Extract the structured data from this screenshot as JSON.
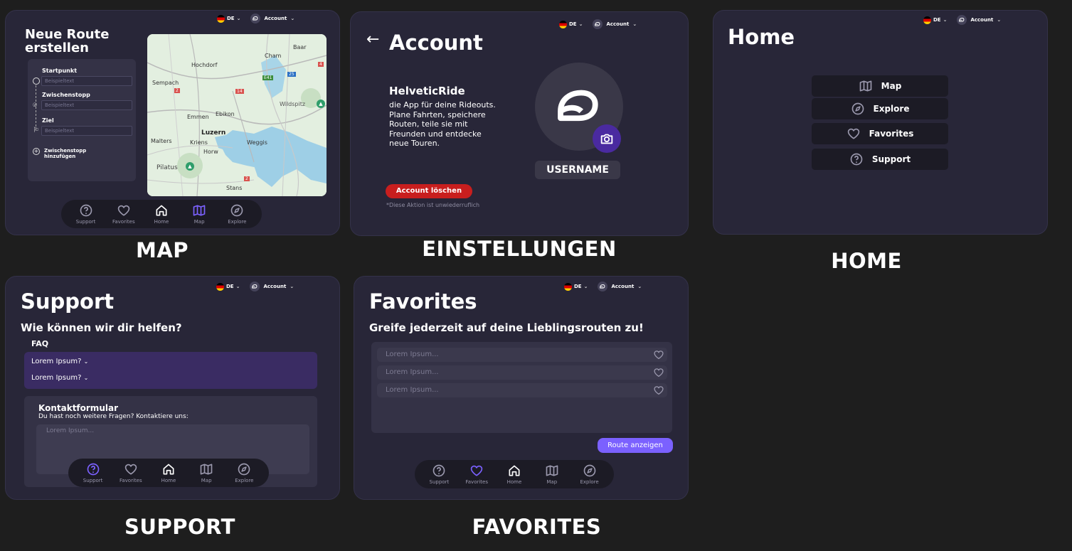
{
  "common": {
    "lang": "DE",
    "account": "Account",
    "nav": {
      "support": "Support",
      "favorites": "Favorites",
      "home": "Home",
      "map": "Map",
      "explore": "Explore"
    }
  },
  "captions": {
    "map": "MAP",
    "settings": "EINSTELLUNGEN",
    "home": "HOME",
    "support": "SUPPORT",
    "favorites": "FAVORITES"
  },
  "map_screen": {
    "title_line1": "Neue Route",
    "title_line2": "erstellen",
    "start_label": "Startpunkt",
    "via_label": "Zwischenstopp",
    "dest_label": "Ziel",
    "placeholder": "Beispieltext",
    "add_stop_line1": "Zwischenstopp",
    "add_stop_line2": "hinzufügen",
    "map_labels": {
      "baar": "Baar",
      "cham": "Cham",
      "hochdorf": "Hochdorf",
      "sempach": "Sempach",
      "emmen": "Emmen",
      "ebikon": "Ebikon",
      "wildspitz": "Wildspitz",
      "luzern": "Luzern",
      "malters": "Malters",
      "kriens": "Kriens",
      "horw": "Horw",
      "weggis": "Weggis",
      "pilatus": "Pilatus",
      "stans": "Stans",
      "r2a": "2",
      "r2b": "2",
      "r14": "14",
      "r25": "25",
      "e41": "E41",
      "r4": "4"
    }
  },
  "account_screen": {
    "title": "Account",
    "app_name": "HelveticRide",
    "description": "die App für deine Rideouts. Plane Fahrten, speichere Routen, teile sie mit Freunden und entdecke neue Touren.",
    "delete_button": "Account löschen",
    "delete_note": "*Diese Aktion ist unwiederruflich",
    "username": "USERNAME"
  },
  "home_screen": {
    "title": "Home",
    "menu": [
      "Map",
      "Explore",
      "Favorites",
      "Support"
    ]
  },
  "support_screen": {
    "title": "Support",
    "subtitle": "Wie können wir dir helfen?",
    "faq_title": "FAQ",
    "faq_items": [
      "Lorem Ipsum?",
      "Lorem Ipsum?"
    ],
    "contact_title": "Kontaktformular",
    "contact_subtitle": "Du hast noch weitere Fragen? Kontaktiere uns:",
    "contact_placeholder": "Lorem Ipsum..."
  },
  "favorites_screen": {
    "title": "Favorites",
    "subtitle": "Greife jederzeit auf deine Lieblingsrouten zu!",
    "items": [
      "Lorem Ipsum...",
      "Lorem Ipsum...",
      "Lorem Ipsum..."
    ],
    "show_route_button": "Route anzeigen"
  },
  "colors": {
    "accent": "#7b61ff",
    "danger": "#c81e1e",
    "screen_bg": "#282638",
    "panel": "#1c1b25",
    "faq_bg": "#3a2c63"
  }
}
